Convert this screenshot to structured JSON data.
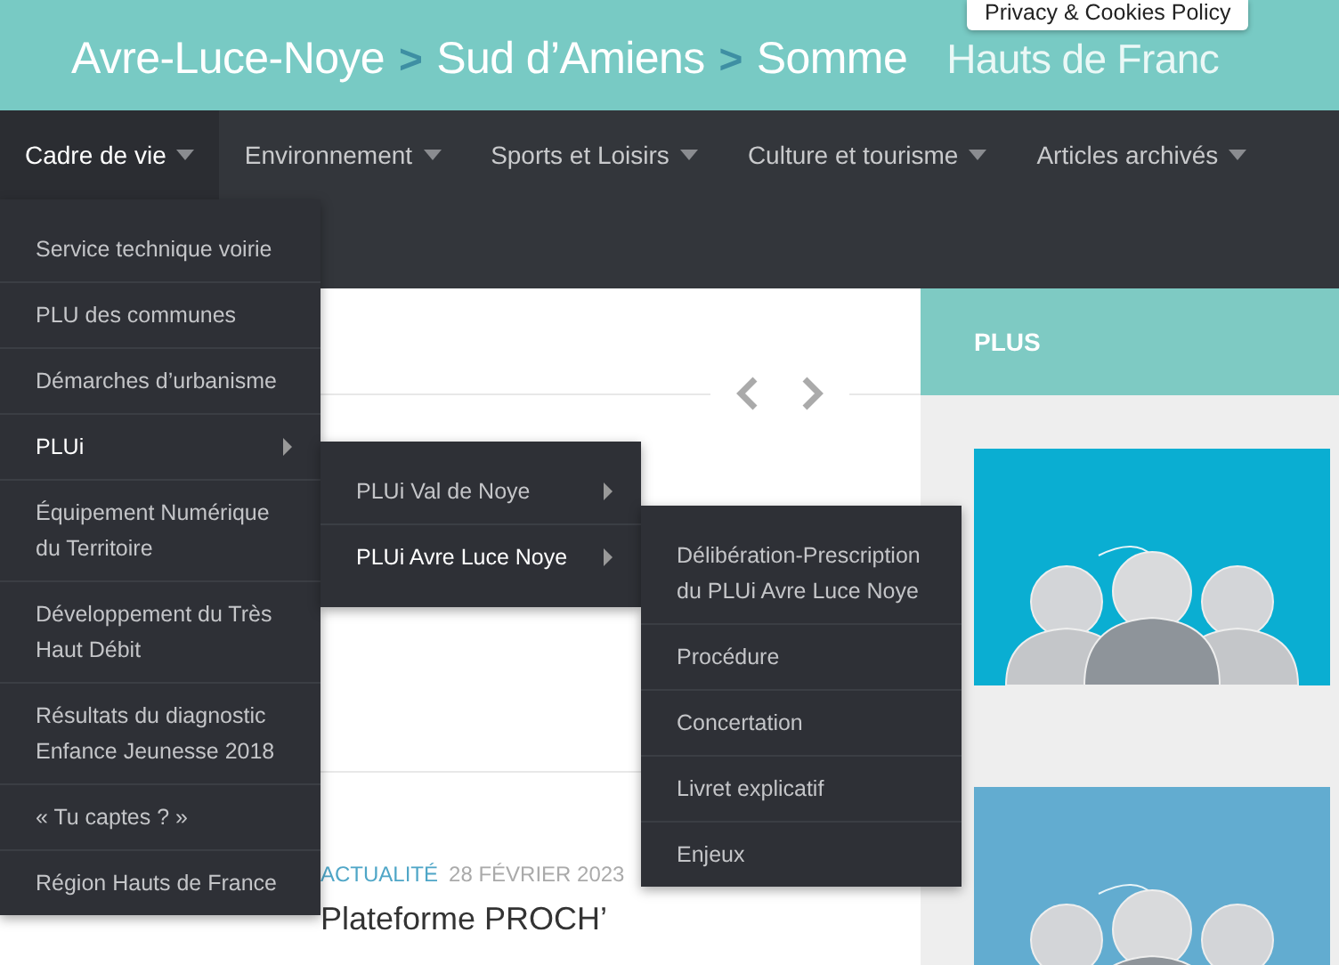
{
  "header": {
    "breadcrumb": [
      {
        "kind": "crumb",
        "text": "Avre-Luce-Noye"
      },
      {
        "kind": "separator",
        "text": ">"
      },
      {
        "kind": "crumb",
        "text": "Sud d’Amiens"
      },
      {
        "kind": "separator",
        "text": ">"
      },
      {
        "kind": "crumb",
        "text": "Somme"
      },
      {
        "kind": "faded",
        "text": "Hauts de Franc"
      }
    ]
  },
  "cookie_notice": {
    "label": "Privacy & Cookies Policy"
  },
  "nav": {
    "items": [
      {
        "label": "Cadre de vie",
        "selected": true,
        "menu": [
          {
            "label": "Service technique voirie",
            "selected": false,
            "submenu": false
          },
          {
            "label": "PLU des communes",
            "selected": false,
            "submenu": false
          },
          {
            "label": "Démarches d’urbanisme",
            "selected": false,
            "submenu": false
          },
          {
            "label": "PLUi",
            "selected": true,
            "submenu": true,
            "children": [
              {
                "label": "PLUi Val de Noye",
                "selected": false,
                "submenu": true
              },
              {
                "label": "PLUi Avre Luce Noye",
                "selected": true,
                "submenu": true,
                "children": [
                  {
                    "label": "Délibération-Prescription du PLUi Avre Luce Noye",
                    "selected": false
                  },
                  {
                    "label": "Procédure",
                    "selected": false
                  },
                  {
                    "label": "Concertation",
                    "selected": false
                  },
                  {
                    "label": "Livret explicatif",
                    "selected": false
                  },
                  {
                    "label": "Enjeux",
                    "selected": false
                  }
                ]
              }
            ]
          },
          {
            "label": "Équipement Numérique du Territoire",
            "selected": false,
            "submenu": false
          },
          {
            "label": "Développement du Très Haut Débit",
            "selected": false,
            "submenu": false
          },
          {
            "label": "Résultats du diagnostic Enfance Jeunesse 2018",
            "selected": false,
            "submenu": false
          },
          {
            "label": "« Tu captes ? »",
            "selected": false,
            "submenu": false
          },
          {
            "label": "Région Hauts de France",
            "selected": false,
            "submenu": false
          }
        ]
      },
      {
        "label": "Environnement",
        "selected": false
      },
      {
        "label": "Sports et Loisirs",
        "selected": false
      },
      {
        "label": "Culture et tourisme",
        "selected": false
      },
      {
        "label": "Articles archivés",
        "selected": false
      }
    ]
  },
  "post": {
    "category": "ACTUALITÉ",
    "date": "28 FÉVRIER 2023",
    "title": "Plateforme PROCH’"
  },
  "sidebar": {
    "title": "PLUS"
  }
}
